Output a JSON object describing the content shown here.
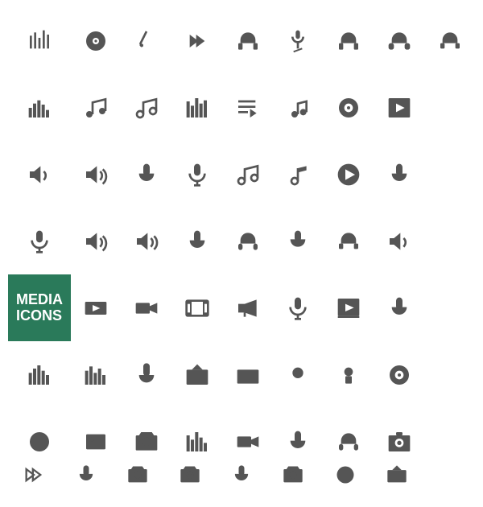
{
  "title": "Media Icons",
  "label_line1": "MEDIA",
  "label_line2": "ICONS",
  "accent_color": "#2a7a5a",
  "icon_color": "#555555"
}
